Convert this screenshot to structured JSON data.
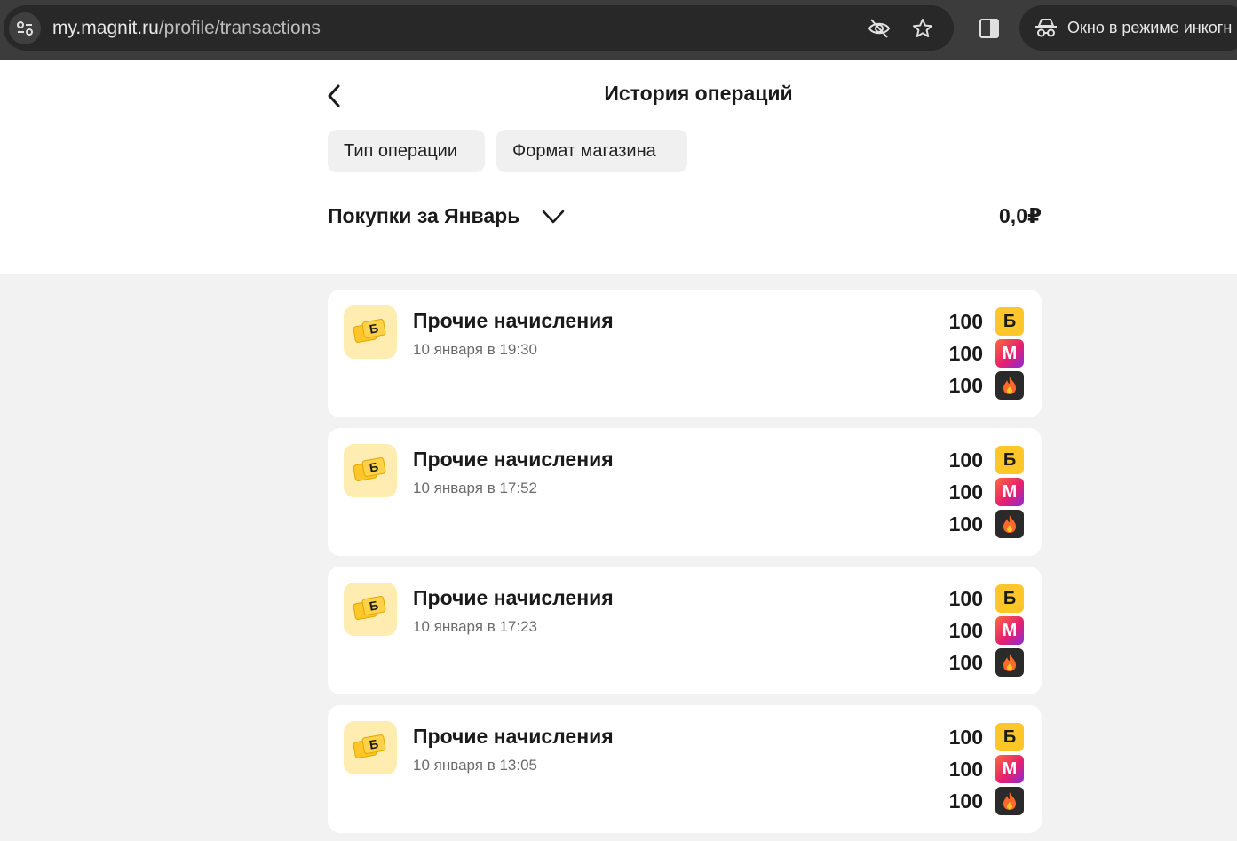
{
  "browser": {
    "url_host": "my.magnit.ru",
    "url_path": "/profile/transactions",
    "incognito_label": "Окно в режиме инкогн"
  },
  "header": {
    "title": "История операций",
    "filters": [
      "Тип операции",
      "Формат магазина"
    ],
    "purchases_label": "Покупки за Январь",
    "purchases_total": "0,0₽"
  },
  "transactions": [
    {
      "title": "Прочие начисления",
      "date": "10 января в 19:30",
      "amounts": [
        "100",
        "100",
        "100"
      ]
    },
    {
      "title": "Прочие начисления",
      "date": "10 января в 17:52",
      "amounts": [
        "100",
        "100",
        "100"
      ]
    },
    {
      "title": "Прочие начисления",
      "date": "10 января в 17:23",
      "amounts": [
        "100",
        "100",
        "100"
      ]
    },
    {
      "title": "Прочие начисления",
      "date": "10 января в 13:05",
      "amounts": [
        "100",
        "100",
        "100"
      ]
    }
  ],
  "badges": {
    "bonus_letter": "Б",
    "magnit_letter": "М"
  },
  "colors": {
    "bonus": "#ffc629",
    "accent_pink": "#e6206e",
    "fire_bg": "#2a2a2a",
    "icon_bg": "#ffecb0"
  }
}
